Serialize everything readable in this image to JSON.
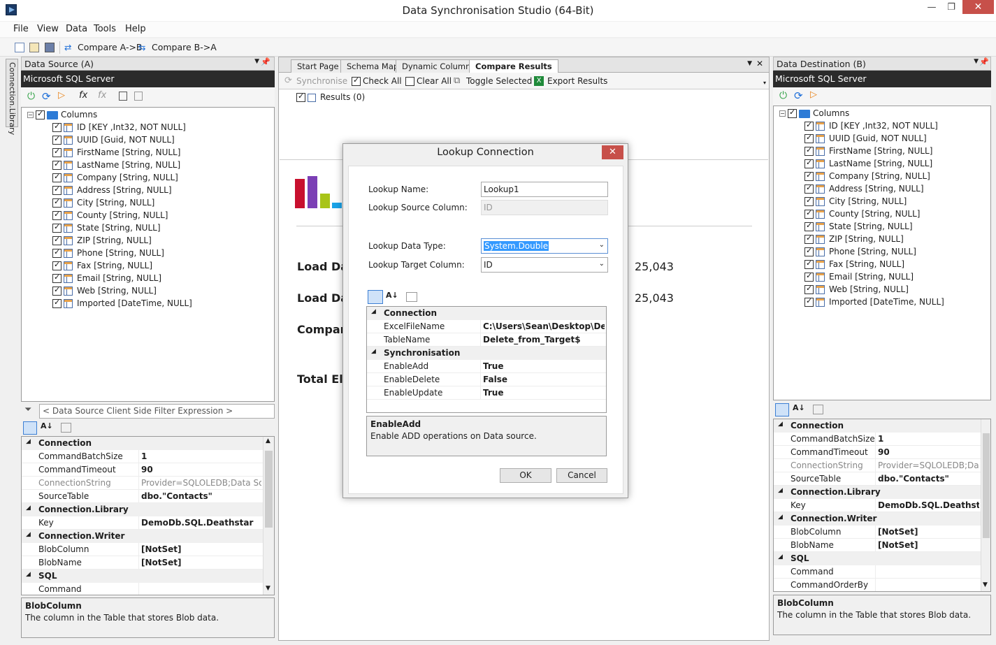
{
  "window": {
    "title": "Data Synchronisation Studio (64-Bit)",
    "minimize": "—",
    "maximize": "❐",
    "close": "✕"
  },
  "menu": [
    "File",
    "View",
    "Data",
    "Tools",
    "Help"
  ],
  "toolbar": {
    "compare_ab": "Compare A->B",
    "compare_ba": "Compare B->A"
  },
  "side_tab": "Connection.Library",
  "source": {
    "header": "Data Source (A)",
    "provider": "Microsoft SQL Server",
    "root": "Columns",
    "columns": [
      "ID [KEY ,Int32, NOT NULL]",
      "UUID [Guid, NOT NULL]",
      "FirstName [String, NULL]",
      "LastName [String, NULL]",
      "Company [String, NULL]",
      "Address [String, NULL]",
      "City [String, NULL]",
      "County [String, NULL]",
      "State [String, NULL]",
      "ZIP [String, NULL]",
      "Phone [String, NULL]",
      "Fax [String, NULL]",
      "Email [String, NULL]",
      "Web [String, NULL]",
      "Imported [DateTime, NULL]"
    ],
    "filter_placeholder": "< Data Source Client Side Filter Expression >",
    "props": [
      {
        "cat": "Connection"
      },
      {
        "name": "CommandBatchSize",
        "value": "1"
      },
      {
        "name": "CommandTimeout",
        "value": "90"
      },
      {
        "name": "ConnectionString",
        "value": "Provider=SQLOLEDB;Data Source",
        "muted": true
      },
      {
        "name": "SourceTable",
        "value": "dbo.\"Contacts\""
      },
      {
        "cat": "Connection.Library"
      },
      {
        "name": "Key",
        "value": "DemoDb.SQL.Deathstar"
      },
      {
        "cat": "Connection.Writer"
      },
      {
        "name": "BlobColumn",
        "value": "[NotSet]"
      },
      {
        "name": "BlobName",
        "value": "[NotSet]"
      },
      {
        "cat": "SQL"
      },
      {
        "name": "Command",
        "value": ""
      }
    ],
    "desc_title": "BlobColumn",
    "desc_text": "The column in the Table that stores Blob data."
  },
  "dest": {
    "header": "Data Destination (B)",
    "provider": "Microsoft SQL Server",
    "root": "Columns",
    "columns": [
      "ID [KEY ,Int32, NOT NULL]",
      "UUID [Guid, NOT NULL]",
      "FirstName [String, NULL]",
      "LastName [String, NULL]",
      "Company [String, NULL]",
      "Address [String, NULL]",
      "City [String, NULL]",
      "County [String, NULL]",
      "State [String, NULL]",
      "ZIP [String, NULL]",
      "Phone [String, NULL]",
      "Fax [String, NULL]",
      "Email [String, NULL]",
      "Web [String, NULL]",
      "Imported [DateTime, NULL]"
    ],
    "props": [
      {
        "cat": "Connection"
      },
      {
        "name": "CommandBatchSize",
        "value": "1"
      },
      {
        "name": "CommandTimeout",
        "value": "90"
      },
      {
        "name": "ConnectionString",
        "value": "Provider=SQLOLEDB;Data S",
        "muted": true
      },
      {
        "name": "SourceTable",
        "value": "dbo.\"Contacts\""
      },
      {
        "cat": "Connection.Library"
      },
      {
        "name": "Key",
        "value": "DemoDb.SQL.Deathstar"
      },
      {
        "cat": "Connection.Writer"
      },
      {
        "name": "BlobColumn",
        "value": "[NotSet]"
      },
      {
        "name": "BlobName",
        "value": "[NotSet]"
      },
      {
        "cat": "SQL"
      },
      {
        "name": "Command",
        "value": ""
      },
      {
        "name": "CommandOrderBy",
        "value": ""
      }
    ],
    "desc_title": "BlobColumn",
    "desc_text": "The column in the Table that stores Blob data."
  },
  "center": {
    "tabs": [
      "Start Page",
      "Schema Map",
      "Dynamic Columns",
      "Compare Results"
    ],
    "actions": {
      "synchronise": "Synchronise",
      "check_all": "Check All",
      "clear_all": "Clear All",
      "toggle_selected": "Toggle Selected",
      "export_results": "Export Results"
    },
    "results_node": "Results (0)",
    "stats": [
      {
        "label": "Load Dat",
        "value": "25,043"
      },
      {
        "label": "Load Dat",
        "value": "25,043"
      },
      {
        "label": "Compare",
        "value": ""
      },
      {
        "label": "Total Ela",
        "value": ""
      }
    ]
  },
  "dialog": {
    "title": "Lookup Connection",
    "lookup_name_label": "Lookup Name:",
    "lookup_name": "Lookup1",
    "source_col_label": "Lookup Source Column:",
    "source_col": "ID",
    "data_type_label": "Lookup Data Type:",
    "data_type": "System.Double",
    "target_col_label": "Lookup Target Column:",
    "target_col": "ID",
    "props": [
      {
        "cat": "Connection"
      },
      {
        "name": "ExcelFileName",
        "value": "C:\\Users\\Sean\\Desktop\\Deletel"
      },
      {
        "name": "TableName",
        "value": "Delete_from_Target$"
      },
      {
        "cat": "Synchronisation"
      },
      {
        "name": "EnableAdd",
        "value": "True"
      },
      {
        "name": "EnableDelete",
        "value": "False"
      },
      {
        "name": "EnableUpdate",
        "value": "True"
      }
    ],
    "desc_title": "EnableAdd",
    "desc_text": "Enable ADD operations on Data source.",
    "ok": "OK",
    "cancel": "Cancel"
  },
  "colors": {
    "dark_bar": "#2b2b2b",
    "accent_blue": "#1e6fd9",
    "close_red": "#c7504a",
    "chart": [
      "#c8102e",
      "#7b3fb5",
      "#a8c418",
      "#1aa3e8"
    ]
  }
}
